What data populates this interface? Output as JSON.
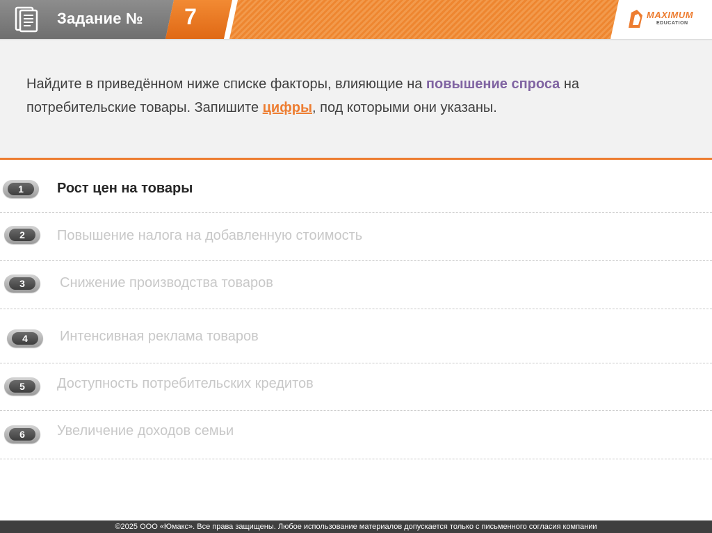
{
  "header": {
    "title": "Задание №",
    "task_number": "7",
    "logo_text": "MAXIMUM",
    "logo_subtext": "EDUCATION",
    "icons": [
      "document-icon",
      "maximum-logo"
    ]
  },
  "task": {
    "text_part1": "Найдите в приведённом ниже списке факторы, влияющие на ",
    "highlight1": "повышение спроса",
    "text_part2": " на потребительские товары. Запишите ",
    "highlight2": "цифры",
    "text_part3": ", под которыми они указаны."
  },
  "options": [
    {
      "number": "1",
      "text": "Рост цен на товары",
      "active": true
    },
    {
      "number": "2",
      "text": "Повышение налога на добавленную стоимость",
      "active": false
    },
    {
      "number": "3",
      "text": "Снижение производства товаров",
      "active": false
    },
    {
      "number": "4",
      "text": "Интенсивная реклама товаров",
      "active": false
    },
    {
      "number": "5",
      "text": "Доступность потребительских кредитов",
      "active": false
    },
    {
      "number": "6",
      "text": "Увеличение доходов семьи",
      "active": false
    }
  ],
  "footer": {
    "text": "©2025 ООО «Юмакс». Все права защищены. Любое использование материалов допускается только с письменного согласия компании"
  },
  "colors": {
    "accent_orange": "#ed7d31",
    "highlight_purple": "#8064a2",
    "header_gray": "#7f7f7f",
    "footer_dark": "#3f3f3f"
  }
}
